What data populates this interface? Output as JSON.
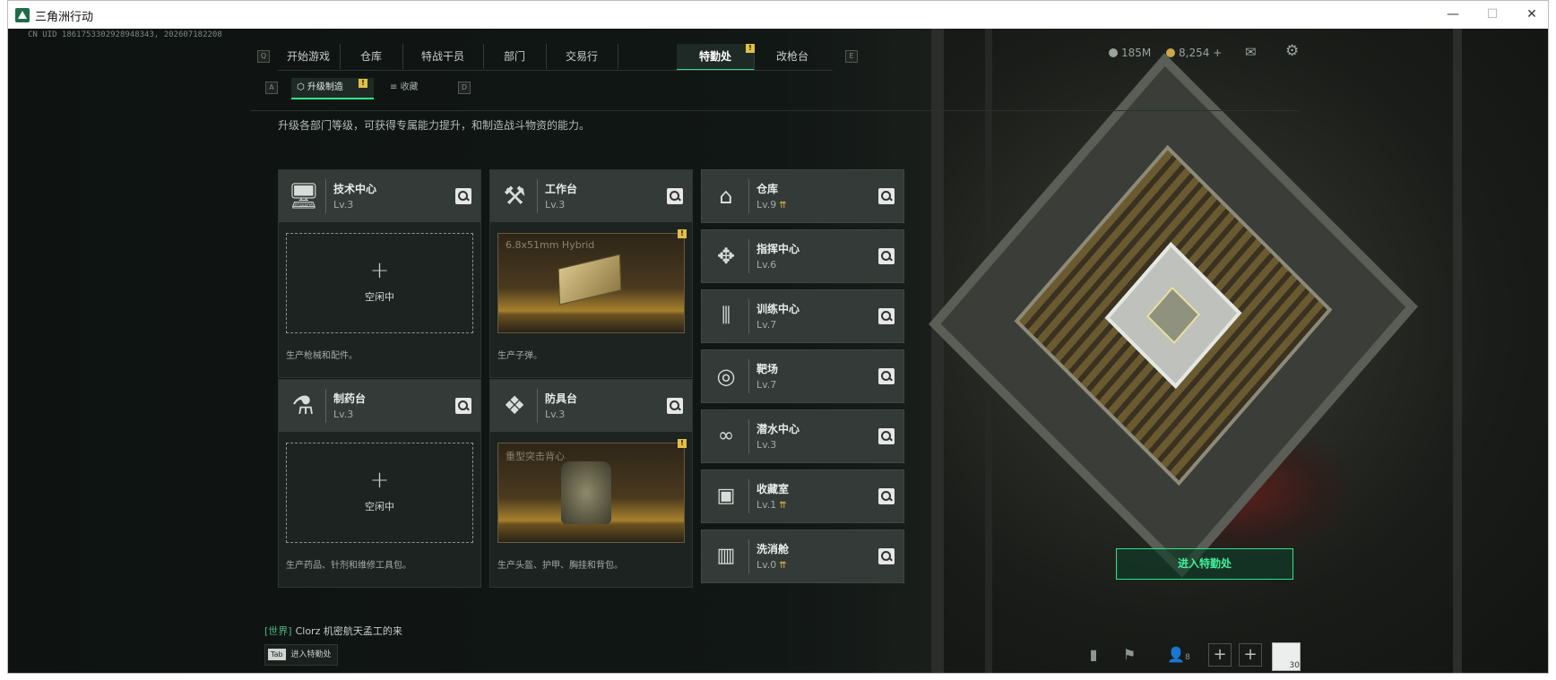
{
  "window": {
    "title": "三角洲行动",
    "minimize": "—",
    "maximize": "☐",
    "close": "✕"
  },
  "uid": "CN UID 1861753302928948343, 202607182208",
  "hotkeys": {
    "left": "Q",
    "right": "E",
    "sub_left": "A",
    "sub_right": "D"
  },
  "tabs": [
    {
      "label": "开始游戏"
    },
    {
      "label": "仓库"
    },
    {
      "label": "特战干员"
    },
    {
      "label": "部门"
    },
    {
      "label": "交易行"
    },
    {
      "label": "特勤处",
      "active": true,
      "badge": "!"
    },
    {
      "label": "改枪台"
    }
  ],
  "subtabs": [
    {
      "label": "升级制造",
      "active": true,
      "badge": "!"
    },
    {
      "label": "收藏"
    }
  ],
  "currency": {
    "coins": "185M",
    "tokens": "8,254",
    "plus": "+"
  },
  "description": "升级各部门等级，可获得专属能力提升，和制造战斗物资的能力。",
  "workstations": [
    {
      "name": "技术中心",
      "level": "Lv.3",
      "status": "空闲中",
      "plus": "+",
      "footer": "生产枪械和配件。"
    },
    {
      "name": "工作台",
      "level": "Lv.3",
      "product": "6.8x51mm Hybrid",
      "footer": "生产子弹。",
      "badge": "!"
    },
    {
      "name": "制药台",
      "level": "Lv.3",
      "status": "空闲中",
      "plus": "+",
      "footer": "生产药品、针剂和维修工具包。"
    },
    {
      "name": "防具台",
      "level": "Lv.3",
      "product": "重型突击背心",
      "footer": "生产头盔、护甲、胸挂和背包。",
      "badge": "!"
    }
  ],
  "facilities": [
    {
      "name": "仓库",
      "level": "Lv.9",
      "upgrade": "⇈"
    },
    {
      "name": "指挥中心",
      "level": "Lv.6"
    },
    {
      "name": "训练中心",
      "level": "Lv.7"
    },
    {
      "name": "靶场",
      "level": "Lv.7"
    },
    {
      "name": "潜水中心",
      "level": "Lv.3"
    },
    {
      "name": "收藏室",
      "level": "Lv.1",
      "upgrade": "⇈"
    },
    {
      "name": "洗消舱",
      "level": "Lv.0",
      "upgrade": "⇈"
    }
  ],
  "enter_button": "进入特勤处",
  "chat": {
    "channel": "[世界]",
    "user": "Clorz",
    "message": "机密航天孟工的来"
  },
  "tab_hint": {
    "key": "Tab",
    "label": "进入特勤处"
  },
  "friends_count": "8",
  "avatar_level": "30",
  "colors": {
    "accent": "#2ee58a",
    "badge": "#e2c044",
    "panel": "#333a37"
  },
  "icons": {
    "window": "app-logo-icon",
    "coin": "coin-icon",
    "token": "token-icon",
    "mail": "mail-icon",
    "settings": "gear-icon"
  }
}
